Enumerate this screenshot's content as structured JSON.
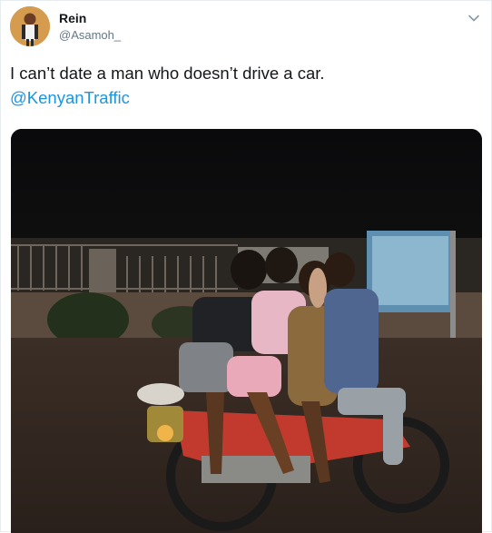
{
  "author": {
    "display_name": "Rein",
    "handle": "@Asamoh_"
  },
  "tweet": {
    "text": "I can’t date a man who doesn’t drive a car.",
    "mention": "@KenyanTraffic"
  },
  "icons": {
    "menu": "chevron-down-icon"
  },
  "colors": {
    "mention": "#1b95e0",
    "handle": "#657786",
    "text": "#14171a"
  }
}
